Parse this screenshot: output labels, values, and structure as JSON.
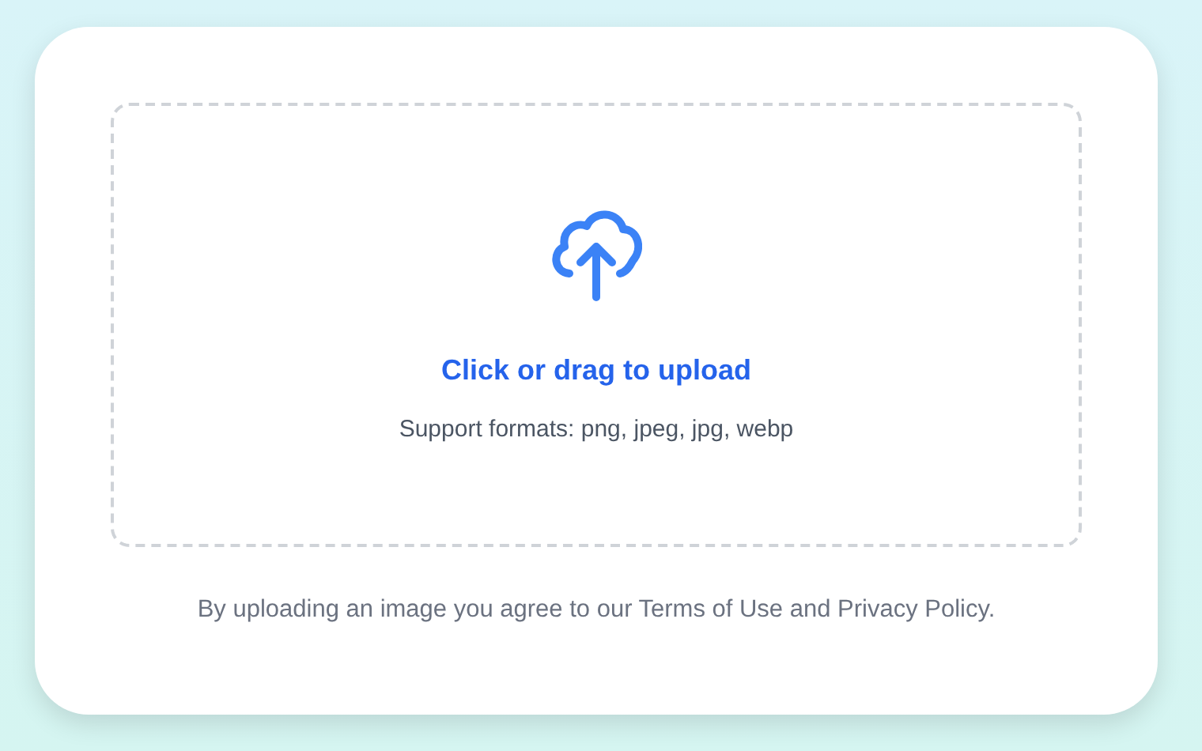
{
  "upload": {
    "title": "Click or drag to upload",
    "formats": "Support formats: png, jpeg, jpg, webp"
  },
  "notice": "By uploading an image you agree to our Terms of Use and Privacy Policy."
}
